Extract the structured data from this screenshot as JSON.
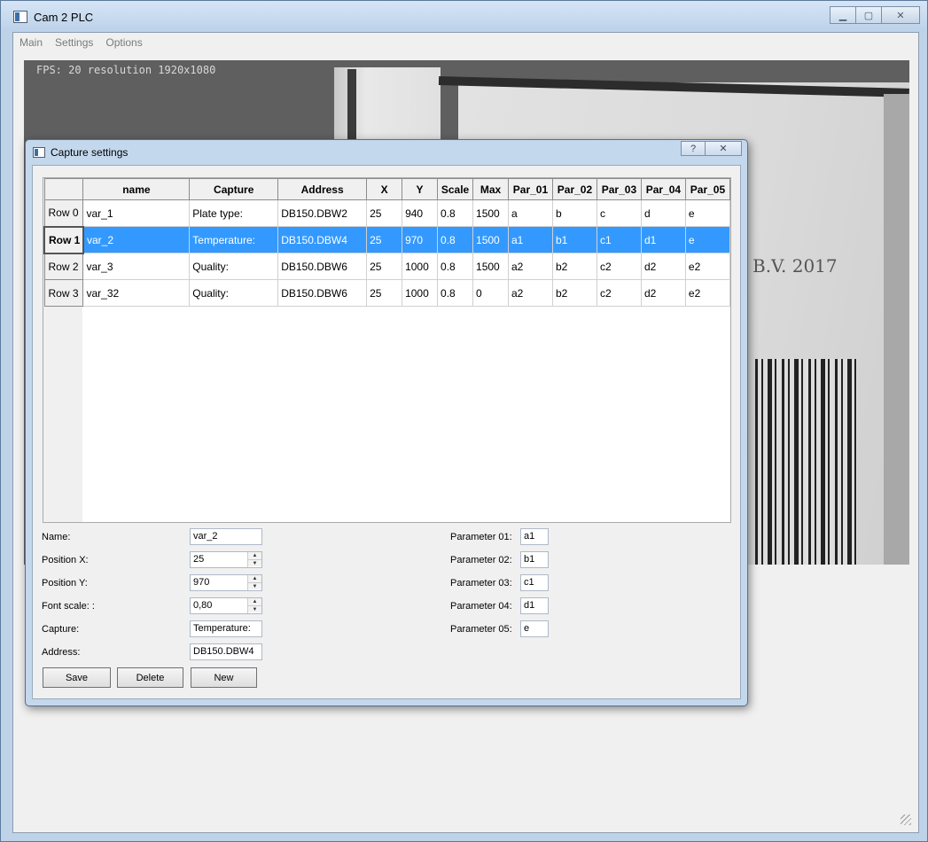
{
  "window": {
    "title": "Cam 2 PLC",
    "minimize": "▁",
    "maximize": "▢",
    "close": "✕"
  },
  "menu": [
    "Main",
    "Settings",
    "Options"
  ],
  "camera": {
    "overlay": "FPS: 20 resolution 1920x1080",
    "scene_text": "B.V. 2017"
  },
  "dialog": {
    "title": "Capture settings",
    "help": "?",
    "close": "✕"
  },
  "table": {
    "columns": [
      "name",
      "Capture",
      "Address",
      "X",
      "Y",
      "Scale",
      "Max",
      "Par_01",
      "Par_02",
      "Par_03",
      "Par_04",
      "Par_05"
    ],
    "rows": [
      {
        "header": "Row 0",
        "cells": [
          "var_1",
          "Plate type:",
          "DB150.DBW2",
          "25",
          "940",
          "0.8",
          "1500",
          "a",
          "b",
          "c",
          "d",
          "e"
        ]
      },
      {
        "header": "Row 1",
        "cells": [
          "var_2",
          "Temperature:",
          "DB150.DBW4",
          "25",
          "970",
          "0.8",
          "1500",
          "a1",
          "b1",
          "c1",
          "d1",
          "e"
        ]
      },
      {
        "header": "Row 2",
        "cells": [
          "var_3",
          "Quality:",
          "DB150.DBW6",
          "25",
          "1000",
          "0.8",
          "1500",
          "a2",
          "b2",
          "c2",
          "d2",
          "e2"
        ]
      },
      {
        "header": "Row 3",
        "cells": [
          "var_32",
          "Quality:",
          "DB150.DBW6",
          "25",
          "1000",
          "0.8",
          "0",
          "a2",
          "b2",
          "c2",
          "d2",
          "e2"
        ]
      }
    ],
    "selected_row": 1
  },
  "form": {
    "name_label": "Name:",
    "name_value": "var_2",
    "posx_label": "Position X:",
    "posx_value": "25",
    "posy_label": "Position Y:",
    "posy_value": "970",
    "scale_label": "Font scale: :",
    "scale_value": "0,80",
    "capture_label": "Capture:",
    "capture_value": "Temperature:",
    "address_label": "Address:",
    "address_value": "DB150.DBW4",
    "params": [
      {
        "label": "Parameter 01:",
        "value": "a1"
      },
      {
        "label": "Parameter 02:",
        "value": "b1"
      },
      {
        "label": "Parameter 03:",
        "value": "c1"
      },
      {
        "label": "Parameter 04:",
        "value": "d1"
      },
      {
        "label": "Parameter 05:",
        "value": "e"
      }
    ],
    "spin_up": "▲",
    "spin_down": "▼"
  },
  "buttons": {
    "save": "Save",
    "delete": "Delete",
    "new": "New"
  },
  "colors": {
    "selection": "#3399ff",
    "titlebar": "#c4d8ed"
  }
}
